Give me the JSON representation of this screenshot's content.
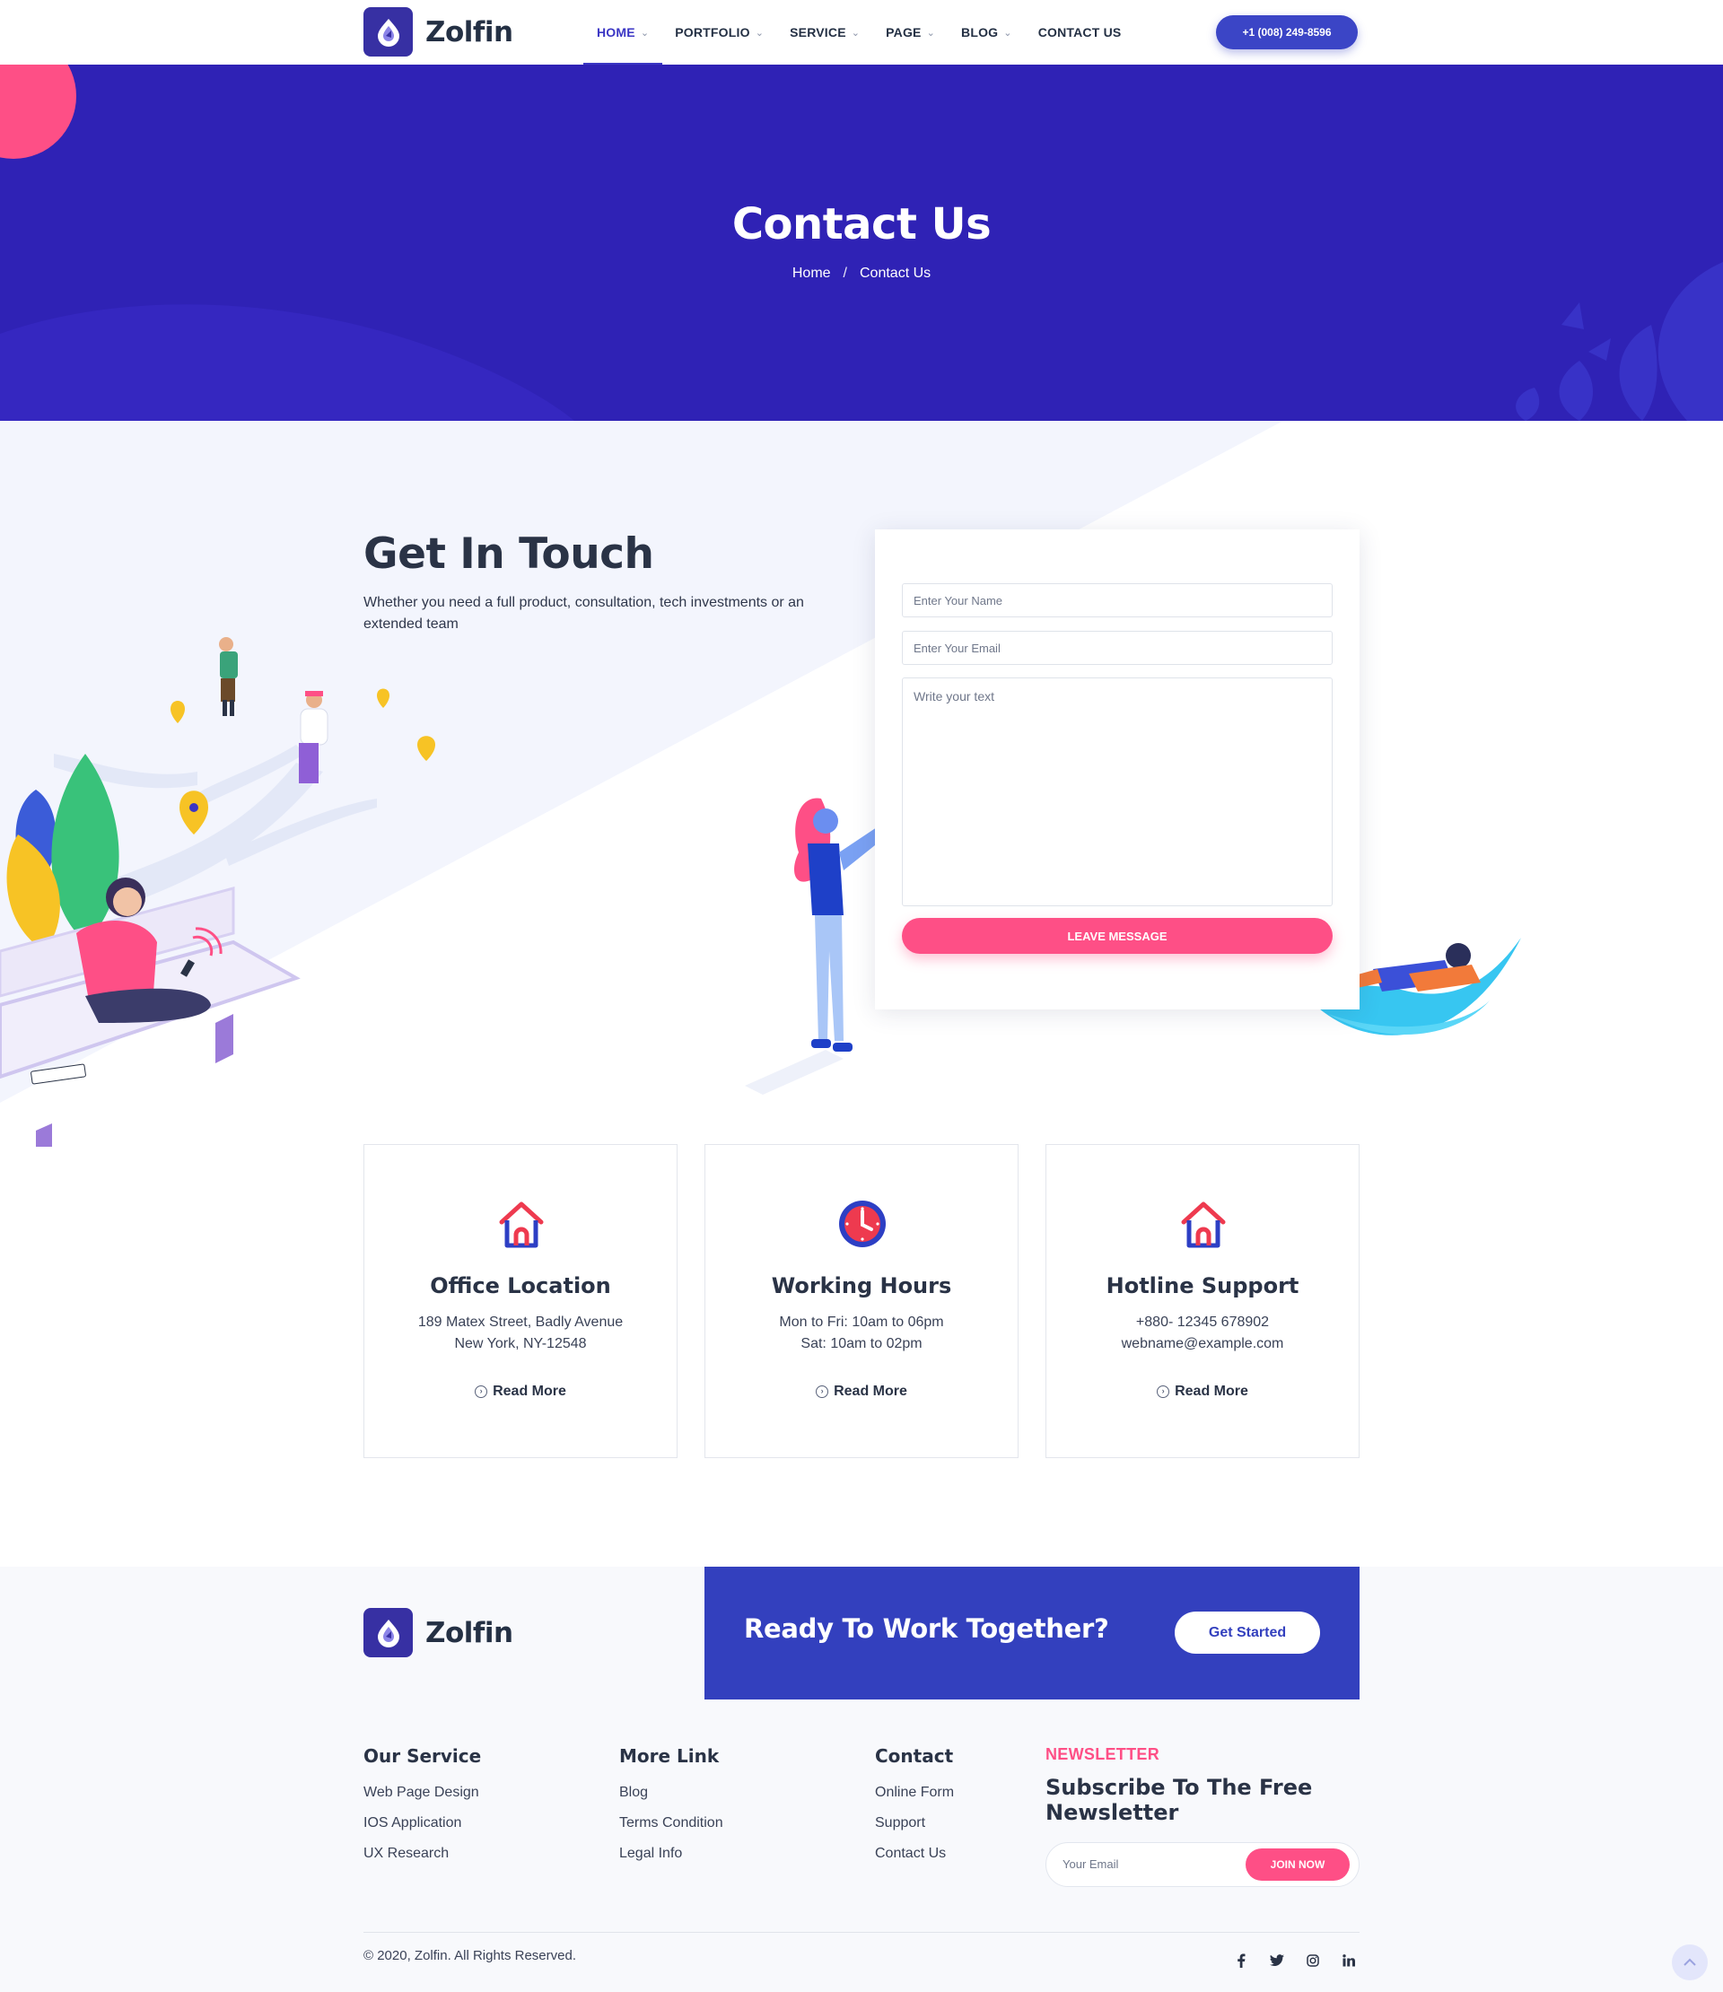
{
  "brand": {
    "name": "Zolfin",
    "primary_color": "#3b36c4",
    "accent_color": "#fe4f86",
    "hero_color": "#2f22b5"
  },
  "navbar": {
    "items": [
      {
        "label": "HOME",
        "active": true,
        "has_dropdown": true
      },
      {
        "label": "PORTFOLIO",
        "active": false,
        "has_dropdown": true
      },
      {
        "label": "SERVICE",
        "active": false,
        "has_dropdown": true
      },
      {
        "label": "PAGE",
        "active": false,
        "has_dropdown": true
      },
      {
        "label": "BLOG",
        "active": false,
        "has_dropdown": true
      },
      {
        "label": "CONTACT US",
        "active": false,
        "has_dropdown": false
      }
    ],
    "phone_button": "+1 (008) 249-8596",
    "dropdown_icon": "chevron-down-icon"
  },
  "hero": {
    "title": "Contact Us",
    "breadcrumb": {
      "home": "Home",
      "separator": "/",
      "current": "Contact Us"
    }
  },
  "touch": {
    "title": "Get In Touch",
    "description": "Whether you need a full product, consultation, tech investments or an extended team"
  },
  "form": {
    "name_placeholder": "Enter Your Name",
    "email_placeholder": "Enter Your Email",
    "message_placeholder": "Write your text",
    "submit_label": "LEAVE MESSAGE"
  },
  "cards": [
    {
      "icon": "house-icon",
      "title": "Office Location",
      "line1": "189 Matex Street, Badly Avenue",
      "line2": "New York, NY-12548",
      "link": "Read More"
    },
    {
      "icon": "clock-icon",
      "title": "Working Hours",
      "line1": "Mon to Fri: 10am to 06pm",
      "line2": "Sat: 10am to 02pm",
      "link": "Read More"
    },
    {
      "icon": "house-icon",
      "title": "Hotline Support",
      "line1": "+880- 12345 678902",
      "line2": "webname@example.com",
      "link": "Read More"
    }
  ],
  "footer": {
    "cta": {
      "text": "Ready To Work Together?",
      "button": "Get Started"
    },
    "columns": [
      {
        "title": "Our Service",
        "links": [
          "Web Page Design",
          "IOS Application",
          "UX Research"
        ]
      },
      {
        "title": "More Link",
        "links": [
          "Blog",
          "Terms Condition",
          "Legal Info"
        ]
      },
      {
        "title": "Contact",
        "links": [
          "Online Form",
          "Support",
          "Contact Us"
        ]
      }
    ],
    "newsletter": {
      "label": "NEWSLETTER",
      "title_line1": "Subscribe To The Free",
      "title_line2": "Newsletter",
      "email_placeholder": "Your Email",
      "button": "JOIN NOW"
    },
    "copyright": "© 2020, Zolfin. All Rights Reserved.",
    "socials": [
      "facebook-icon",
      "twitter-icon",
      "instagram-icon",
      "linkedin-icon"
    ]
  }
}
